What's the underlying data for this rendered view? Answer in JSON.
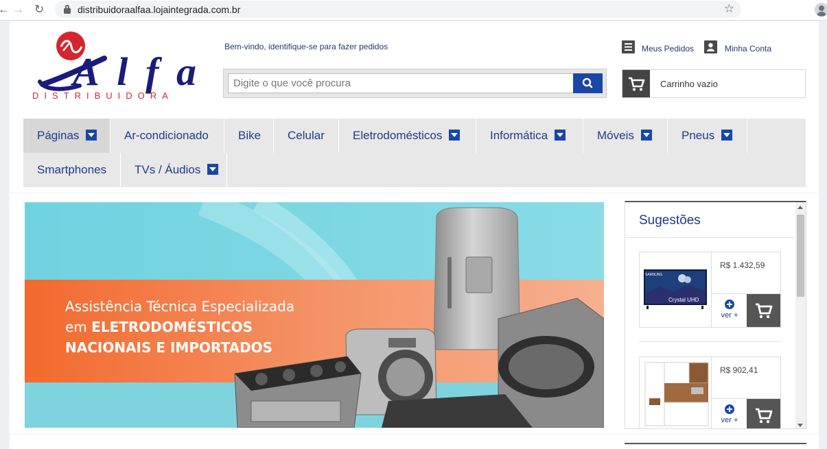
{
  "browser": {
    "url": "distribuidoraalfaa.lojaintegrada.com.br",
    "back_icon": "arrow-left-icon",
    "forward_icon": "arrow-right-icon",
    "reload_icon": "reload-icon",
    "bookmark_icon": "star-icon"
  },
  "header": {
    "logo_text": "Alfa",
    "logo_subtext": "DISTRIBUIDORA",
    "welcome_text": "Bem-vindo, identifique-se",
    "welcome_link": "para fazer pedidos",
    "search_placeholder": "Digite o que você procura",
    "my_orders": "Meus Pedidos",
    "my_account": "Minha Conta",
    "cart_text": "Carrinho vazio"
  },
  "menu": {
    "items": [
      {
        "label": "Páginas",
        "dropdown": true
      },
      {
        "label": "Ar-condicionado",
        "dropdown": false
      },
      {
        "label": "Bike",
        "dropdown": false
      },
      {
        "label": "Celular",
        "dropdown": false
      },
      {
        "label": "Eletrodomésticos",
        "dropdown": true
      },
      {
        "label": "Informática",
        "dropdown": true
      },
      {
        "label": "Móveis",
        "dropdown": true
      },
      {
        "label": "Pneus",
        "dropdown": true
      },
      {
        "label": "Smartphones",
        "dropdown": false
      },
      {
        "label": "TVs / Áudios",
        "dropdown": true
      }
    ]
  },
  "banner": {
    "line1": "Assistência Técnica Especializada",
    "line2_prefix": "em ",
    "line2_bold": "ELETRODOMÉSTICOS",
    "line3": "NACIONAIS E IMPORTADOS"
  },
  "sidebar": {
    "title": "Sugestões",
    "products": [
      {
        "price": "R$ 1.432,59",
        "more": "ver +",
        "image_brand": "SAMSUNG",
        "image_caption": "Crystal UHD"
      },
      {
        "price": "R$ 902,41",
        "more": "ver +"
      }
    ]
  },
  "colors": {
    "accent": "#1a47a6",
    "brand_red": "#d3262e",
    "brand_navy": "#1b1b7a",
    "menu_bg": "#e8e8e8",
    "link": "#1f3a8a"
  }
}
